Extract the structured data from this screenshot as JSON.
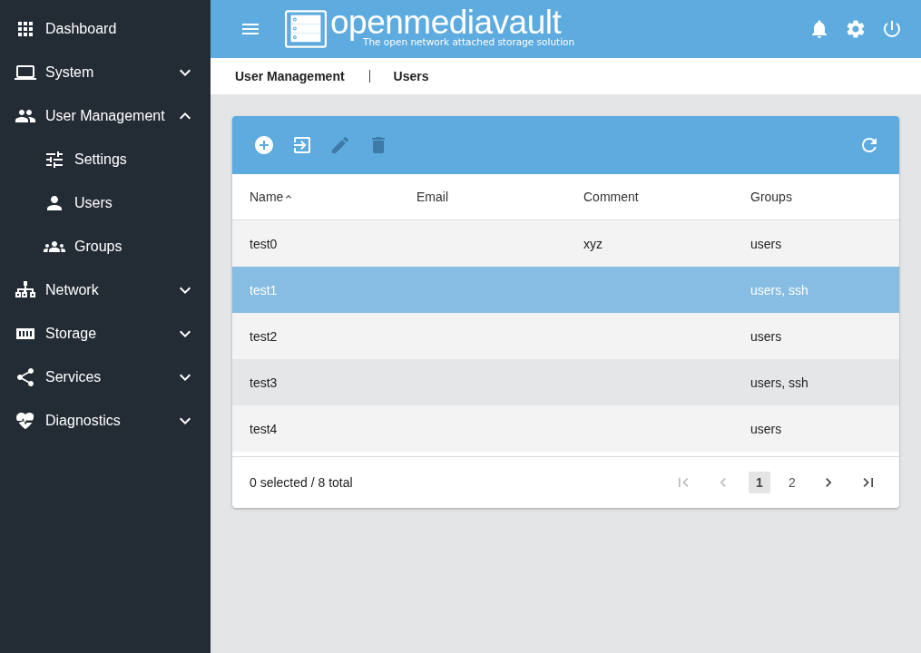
{
  "sidebar": {
    "items": [
      {
        "label": "Dashboard"
      },
      {
        "label": "System",
        "expanded": false
      },
      {
        "label": "User Management",
        "expanded": true,
        "children": [
          {
            "label": "Settings"
          },
          {
            "label": "Users"
          },
          {
            "label": "Groups"
          }
        ]
      },
      {
        "label": "Network",
        "expanded": false
      },
      {
        "label": "Storage",
        "expanded": false
      },
      {
        "label": "Services",
        "expanded": false
      },
      {
        "label": "Diagnostics",
        "expanded": false
      }
    ]
  },
  "header": {
    "logo_text": "openmediavault",
    "tagline": "The open network attached storage solution"
  },
  "breadcrumb": [
    "User Management",
    "Users"
  ],
  "toolbar": {
    "actions": [
      {
        "disabled": false
      },
      {
        "disabled": false
      },
      {
        "disabled": true
      },
      {
        "disabled": true
      }
    ]
  },
  "table": {
    "columns": [
      {
        "label": "Name",
        "sorted": true
      },
      {
        "label": "Email",
        "sorted": false
      },
      {
        "label": "Comment",
        "sorted": false
      },
      {
        "label": "Groups",
        "sorted": false
      }
    ],
    "rows": [
      {
        "cells": [
          "test0",
          "",
          "xyz",
          "users"
        ],
        "selected": false,
        "hovered": false
      },
      {
        "cells": [
          "test1",
          "",
          "",
          "users, ssh"
        ],
        "selected": true,
        "hovered": false
      },
      {
        "cells": [
          "test2",
          "",
          "",
          "users"
        ],
        "selected": false,
        "hovered": false
      },
      {
        "cells": [
          "test3",
          "",
          "",
          "users, ssh"
        ],
        "selected": false,
        "hovered": true
      },
      {
        "cells": [
          "test4",
          "",
          "",
          "users"
        ],
        "selected": false,
        "hovered": false
      }
    ]
  },
  "footer": {
    "summary": "0 selected / 8 total",
    "first_disabled": true,
    "prev_disabled": true,
    "pages": [
      {
        "label": "1",
        "selected": true
      },
      {
        "label": "2",
        "selected": false
      }
    ]
  }
}
